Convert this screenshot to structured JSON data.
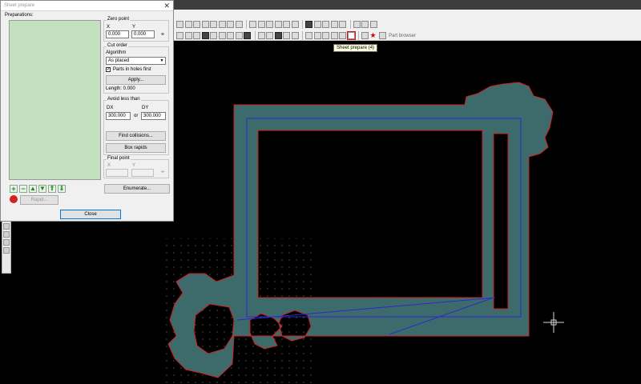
{
  "dialog": {
    "title": "Sheet prepare",
    "close_glyph": "✕",
    "preparations_label": "Preparations:",
    "zero_point": {
      "label": "Zero point",
      "x_label": "X",
      "y_label": "Y",
      "x_value": "0.000",
      "y_value": "0.000"
    },
    "cut_order": {
      "label": "Cut order",
      "algorithm_label": "Algorithm",
      "algorithm_value": "As placed",
      "parts_in_holes_label": "Parts in holes first",
      "parts_in_holes_checked": true,
      "apply_label": "Apply...",
      "length_label": "Length: 0.000"
    },
    "avoid": {
      "label": "Avoid less than",
      "dx_label": "DX",
      "dy_label": "DY",
      "dx_value": "300.000",
      "or_label": "or",
      "dy_value": "300.000",
      "find_collisions_label": "Find collisions...",
      "box_rapids_label": "Box rapids"
    },
    "final_point": {
      "label": "Final point",
      "x_label": "X",
      "y_label": "Y",
      "x_value": "",
      "y_value": ""
    },
    "enumerate_label": "Enumerate...",
    "rapid_label": "Rapid...",
    "close_label": "Close",
    "control_icons": [
      "add-icon",
      "remove-icon",
      "move-up-icon",
      "move-down-icon",
      "move-top-icon",
      "move-bottom-icon",
      "stop-icon"
    ]
  },
  "toolbar": {
    "part_browser_label": "Part browser",
    "highlighted_tool": "sheet-prepare-icon"
  },
  "tooltip": {
    "text": "Sheet prepare (4)"
  },
  "colors": {
    "part_fill": "#3d6b6b",
    "part_outline": "#d02020",
    "toolpath": "#2a2ad0",
    "preparations_bg": "#c4e0c0"
  }
}
